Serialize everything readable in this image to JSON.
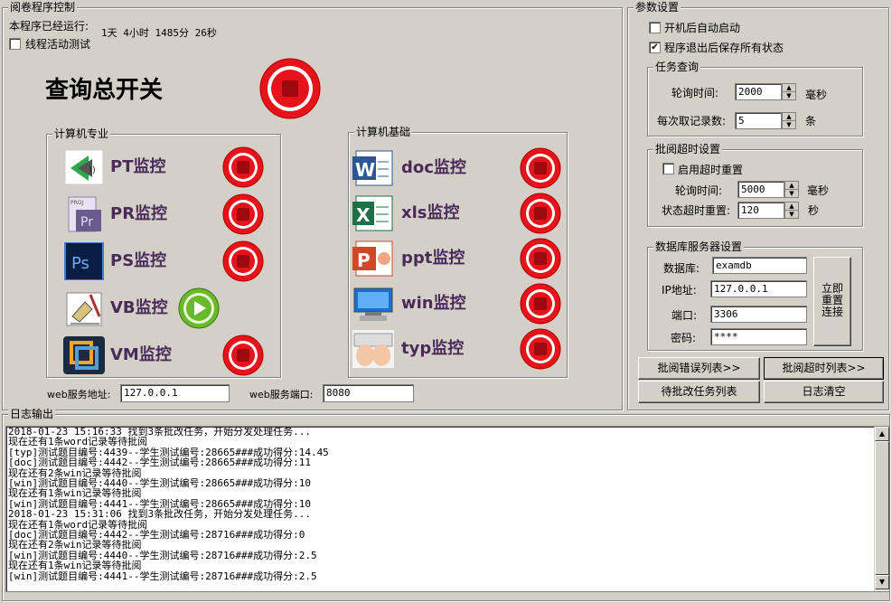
{
  "control": {
    "title": "阅卷程序控制",
    "runtime_label": "本程序已经运行:",
    "runtime_value": "1天 4小时 1485分 26秒",
    "thread_test_label": "线程活动测试",
    "query_switch_label": "查询总开关"
  },
  "computer_major": {
    "title": "计算机专业",
    "items": [
      {
        "label": "PT监控",
        "icon": "pt-app-icon",
        "state": "stop"
      },
      {
        "label": "PR监控",
        "icon": "premiere-icon",
        "state": "stop"
      },
      {
        "label": "PS监控",
        "icon": "photoshop-icon",
        "state": "stop"
      },
      {
        "label": "VB监控",
        "icon": "visual-basic-icon",
        "state": "play"
      },
      {
        "label": "VM监控",
        "icon": "vmware-icon",
        "state": "stop"
      }
    ]
  },
  "computer_basic": {
    "title": "计算机基础",
    "items": [
      {
        "label": "doc监控",
        "icon": "word-icon",
        "state": "stop"
      },
      {
        "label": "xls监控",
        "icon": "excel-icon",
        "state": "stop"
      },
      {
        "label": "ppt监控",
        "icon": "powerpoint-icon",
        "state": "stop"
      },
      {
        "label": "win监控",
        "icon": "windows-icon",
        "state": "stop"
      },
      {
        "label": "typ监控",
        "icon": "typing-icon",
        "state": "stop"
      }
    ]
  },
  "web": {
    "address_label": "web服务地址:",
    "address_value": "127.0.0.1",
    "port_label": "web服务端口:",
    "port_value": "8080"
  },
  "params": {
    "title": "参数设置",
    "autostart_label": "开机后自动启动",
    "autostart_checked": false,
    "save_state_label": "程序退出后保存所有状态",
    "save_state_checked": true,
    "task_query": {
      "title": "任务查询",
      "poll_label": "轮询时间:",
      "poll_value": "2000",
      "poll_unit": "毫秒",
      "fetch_label": "每次取记录数:",
      "fetch_value": "5",
      "fetch_unit": "条"
    },
    "timeout": {
      "title": "批阅超时设置",
      "enable_label": "启用超时重置",
      "enable_checked": false,
      "poll_label": "轮询时间:",
      "poll_value": "5000",
      "poll_unit": "毫秒",
      "reset_label": "状态超时重置:",
      "reset_value": "120",
      "reset_unit": "秒"
    },
    "db": {
      "title": "数据库服务器设置",
      "db_label": "数据库:",
      "db_value": "examdb",
      "ip_label": "IP地址:",
      "ip_value": "127.0.0.1",
      "port_label": "端口:",
      "port_value": "3306",
      "pwd_label": "密码:",
      "pwd_value": "****",
      "reconnect_label": "立即重置连接"
    }
  },
  "buttons": {
    "error_list": "批阅错误列表>>",
    "timeout_list": "批阅超时列表>>",
    "pending_list": "待批改任务列表",
    "clear_log": "日志清空"
  },
  "log": {
    "title": "日志输出",
    "lines": [
      "2018-01-23 15:16:33 找到3条批改任务，开始分发处理任务...",
      "现在还有1条word记录等待批阅",
      "[typ]测试题目编号:4439--学生测试编号:28665###成功得分:14.45",
      "[doc]测试题目编号:4442--学生测试编号:28665###成功得分:11",
      "现在还有2条win记录等待批阅",
      "[win]测试题目编号:4440--学生测试编号:28665###成功得分:10",
      "现在还有1条win记录等待批阅",
      "[win]测试题目编号:4441--学生测试编号:28665###成功得分:10",
      "2018-01-23 15:31:06 找到3条批改任务，开始分发处理任务...",
      "现在还有1条word记录等待批阅",
      "[doc]测试题目编号:4442--学生测试编号:28716###成功得分:0",
      "现在还有2条win记录等待批阅",
      "[win]测试题目编号:4440--学生测试编号:28716###成功得分:2.5",
      "现在还有1条win记录等待批阅",
      "[win]测试题目编号:4441--学生测试编号:28716###成功得分:2.5"
    ]
  },
  "colors": {
    "window_bg": "#d4d0c8",
    "stop_red": "#e8131a",
    "play_green": "#6ab82c",
    "label_purple": "#4a2a5a"
  }
}
